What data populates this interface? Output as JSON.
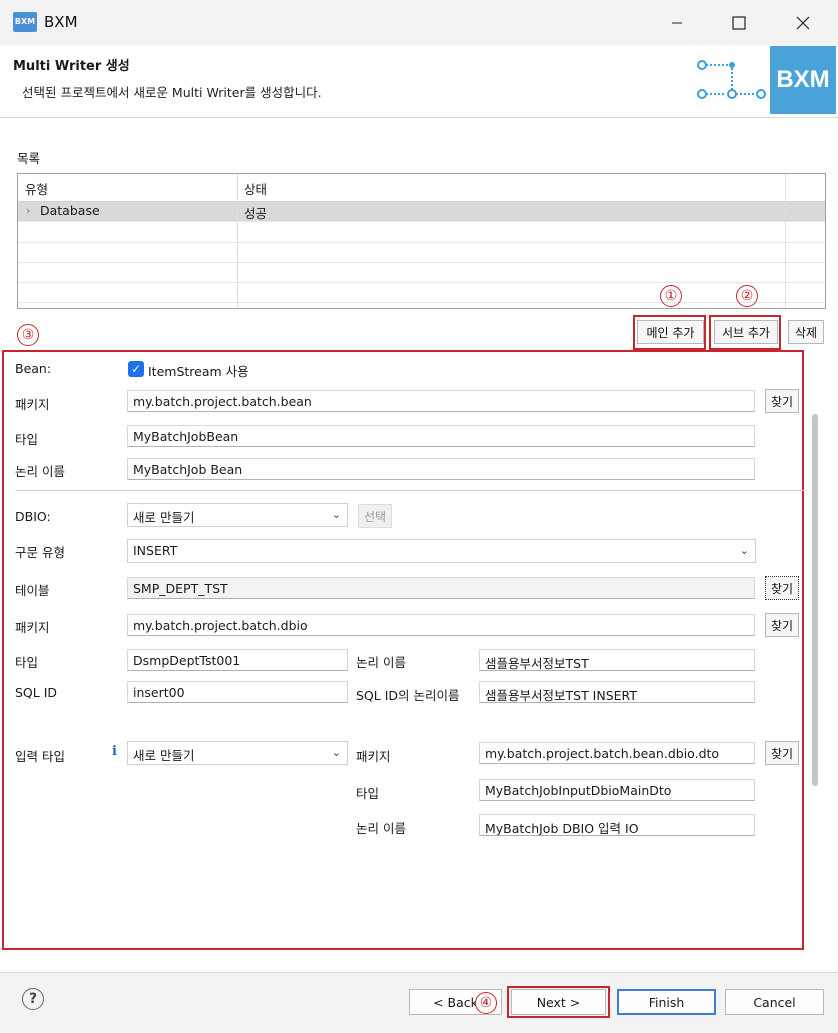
{
  "window": {
    "app_icon": "BXM",
    "title": "BXM",
    "minimize_icon": "minimize-icon",
    "maximize_icon": "maximize-icon",
    "close_icon": "close-icon"
  },
  "header": {
    "title": "Multi Writer 생성",
    "description": "선택된 프로젝트에서 새로운 Multi Writer를 생성합니다.",
    "logo_text": "BXM"
  },
  "list_section": {
    "label": "목록",
    "columns": [
      "유형",
      "상태"
    ],
    "rows": [
      {
        "type": "Database",
        "status": "성공"
      }
    ]
  },
  "list_buttons": {
    "main_add": "메인 추가",
    "sub_add": "서브 추가",
    "delete": "삭제"
  },
  "annotations": {
    "n1": "①",
    "n2": "②",
    "n3": "③",
    "n4": "④",
    "color": "#c8252c"
  },
  "bean": {
    "label": "Bean:",
    "itemstream_label": "ItemStream 사용",
    "itemstream_checked": true,
    "package_label": "패키지",
    "package_value": "my.batch.project.batch.bean",
    "type_label": "타입",
    "type_value": "MyBatchJobBean",
    "logical_name_label": "논리 이름",
    "logical_name_value": "MyBatchJob Bean",
    "find_label": "찾기"
  },
  "dbio": {
    "label": "DBIO:",
    "mode_value": "새로 만들기",
    "select_button": "선택",
    "stmt_type_label": "구문 유형",
    "stmt_type_value": "INSERT",
    "table_label": "테이블",
    "table_value": "SMP_DEPT_TST",
    "package_label": "패키지",
    "package_value": "my.batch.project.batch.dbio",
    "type_label": "타입",
    "type_value": "DsmpDeptTst001",
    "logical_name_label": "논리 이름",
    "logical_name_value": "샘플용부서정보TST",
    "sqlid_label": "SQL ID",
    "sqlid_value": "insert00",
    "sqlid_logical_label": "SQL ID의 논리이름",
    "sqlid_logical_value": "샘플용부서정보TST INSERT",
    "find_label": "찾기"
  },
  "input_type": {
    "label": "입력 타입",
    "info_icon": "info-icon",
    "mode_value": "새로 만들기",
    "package_label": "패키지",
    "package_value": "my.batch.project.batch.bean.dbio.dto",
    "type_label": "타입",
    "type_value": "MyBatchJobInputDbioMainDto",
    "logical_name_label": "논리 이름",
    "logical_name_value": "MyBatchJob DBIO 입력 IO",
    "find_label": "찾기"
  },
  "footer": {
    "help_icon": "help-icon",
    "back": "< Back",
    "next": "Next >",
    "finish": "Finish",
    "cancel": "Cancel"
  }
}
